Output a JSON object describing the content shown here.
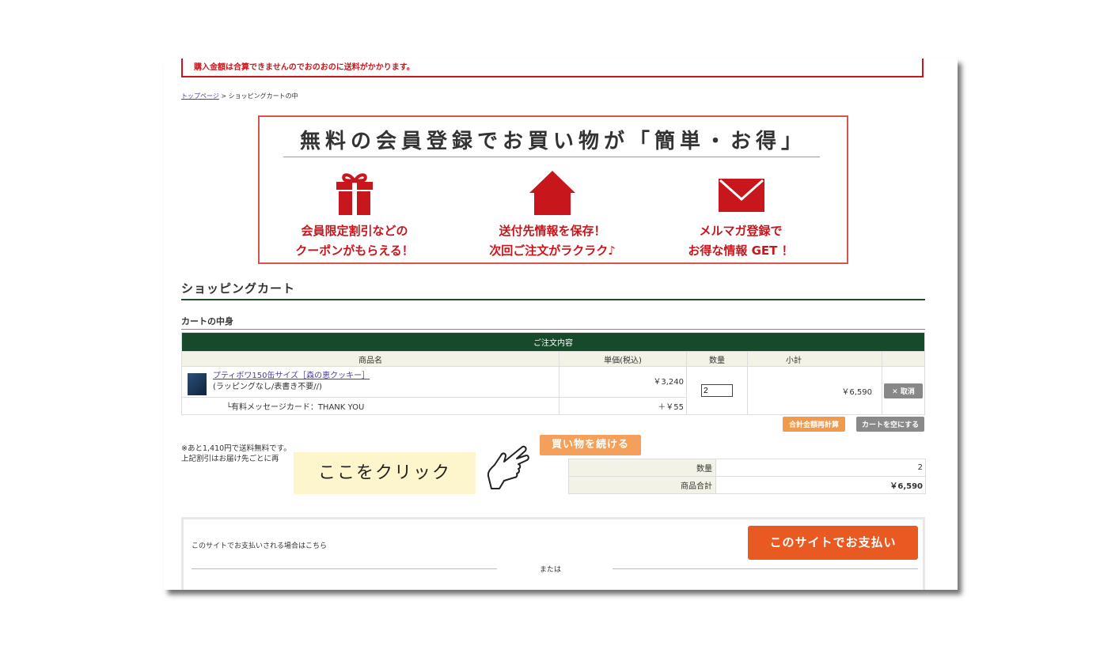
{
  "notice": "購入金額は合算できませんのでおのおのに送料がかかります。",
  "breadcrumb": {
    "home": "トップページ",
    "sep": " > ",
    "current": "ショッピングカートの中"
  },
  "banner": {
    "title": "無料の会員登録でお買い物が「簡単・お得」",
    "features": [
      {
        "icon": "gift-icon",
        "line1": "会員限定割引などの",
        "line2": "クーポンがもらえる！"
      },
      {
        "icon": "house-icon",
        "line1": "送付先情報を保存！",
        "line2": "次回ご注文がラクラク♪"
      },
      {
        "icon": "mail-icon",
        "line1": "メルマガ登録で",
        "line2": "お得な情報 GET ！"
      }
    ],
    "color": "#c8161d"
  },
  "cart": {
    "heading": "ショッピングカート",
    "subheading": "カートの中身",
    "table_title": "ご注文内容",
    "columns": [
      "商品名",
      "単価(税込)",
      "数量",
      "小計",
      ""
    ],
    "item": {
      "name": "プティボワ150缶サイズ［森の恵クッキー］",
      "options": "(ラッピングなし/表書き不要//)",
      "price": "￥3,240",
      "quantity": "2",
      "subtotal": "￥6,590",
      "cancel": "✕ 取消",
      "addon_label": "└有料メッセージカード：THANK YOU",
      "addon_price": "＋￥55"
    },
    "recalc_label": "合計金額再計算",
    "empty_label": "カートを空にする",
    "free_shipping_note": "※あと1,410円で送料無料です。",
    "discount_note": "上記割引はお届け先ごとに再",
    "continue_label": "買い物を続ける",
    "tooltip": "ここをクリック",
    "summary": [
      {
        "label": "数量",
        "value": "2"
      },
      {
        "label": "商品合計",
        "value": "￥6,590"
      }
    ]
  },
  "payment": {
    "text": "このサイトでお支払いされる場合はこちら",
    "button": "このサイトでお支払い",
    "or": "または"
  },
  "colors": {
    "dark_green": "#164a2a",
    "orange": "#f4a05a",
    "pay_orange": "#e85a21",
    "red": "#c8161d"
  }
}
